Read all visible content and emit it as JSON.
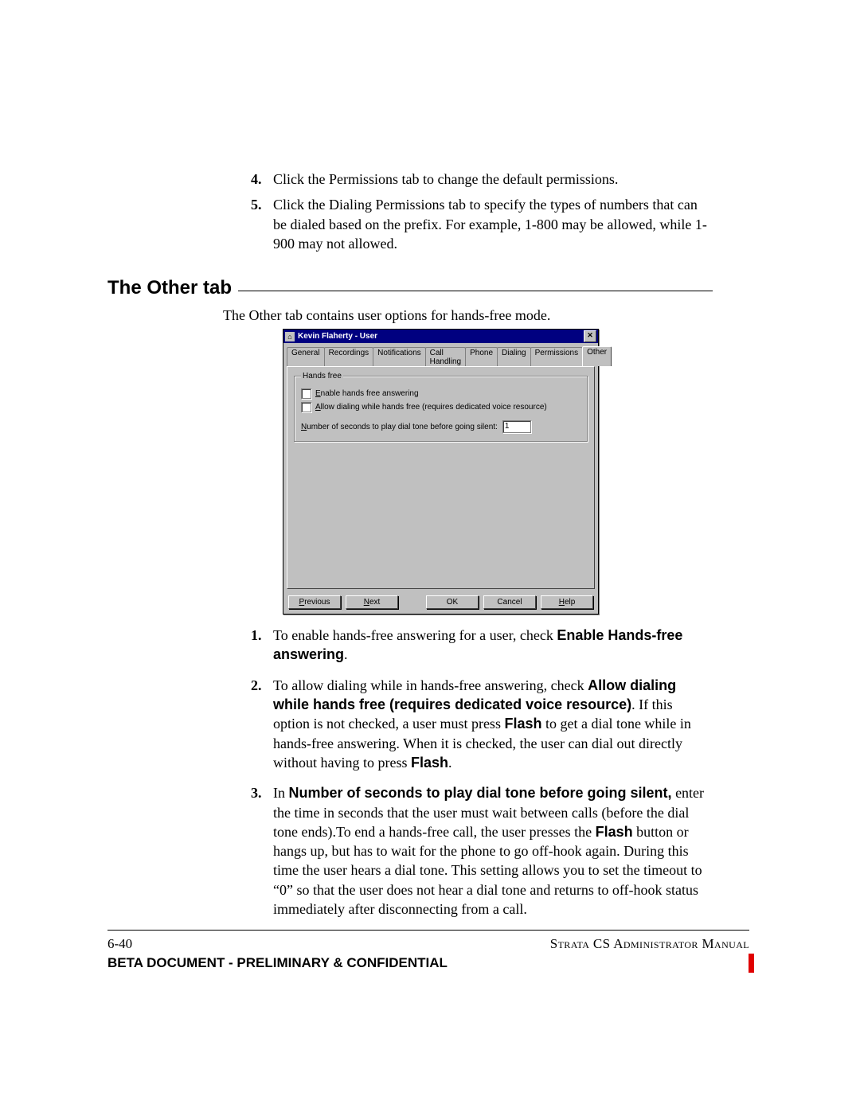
{
  "steps_before": [
    "Click the Permissions tab to change the default permissions.",
    "Click the Dialing Permissions tab to specify the types of numbers that can be dialed based on the prefix. For example, 1-800 may be allowed, while 1-900 may not allowed."
  ],
  "section_heading": "The Other tab",
  "intro": "The Other tab contains user options for hands-free mode.",
  "dialog": {
    "title": "Kevin Flaherty - User",
    "close_glyph": "✕",
    "tabs": [
      "General",
      "Recordings",
      "Notifications",
      "Call Handling",
      "Phone",
      "Dialing",
      "Permissions",
      "Other"
    ],
    "active_tab_index": 7,
    "group_legend": "Hands free",
    "check1_label": "Enable hands free answering",
    "check1_ul": "E",
    "check2_label": "Allow dialing while hands free (requires dedicated voice resource)",
    "check2_ul": "A",
    "num_label": "Number of seconds to play dial tone before going silent:",
    "num_ul": "N",
    "num_value": "1",
    "buttons": {
      "previous": "Previous",
      "next": "Next",
      "ok": "OK",
      "cancel": "Cancel",
      "help": "Help"
    }
  },
  "steps_after": {
    "1": {
      "pre": "To enable hands-free answering for a user, check ",
      "bold": "Enable Hands-free answering",
      "post": "."
    },
    "2": {
      "pre": "To allow dialing while in hands-free answering, check ",
      "bold1": "Allow dialing while hands free (requires dedicated voice resource)",
      "mid1": ". If this option is not checked, a user must press ",
      "bold2": "Flash",
      "mid2": " to get a dial tone while in hands-free answering. When it is checked, the user can dial out directly without having to press ",
      "bold3": "Flash",
      "post": "."
    },
    "3": {
      "pre": "In ",
      "bold1": "Number of seconds to play dial tone before going silent,",
      "mid1": " enter the time in seconds that the user must wait between calls (before the dial tone ends).To end a hands-free call, the user presses the ",
      "bold2": "Flash",
      "mid2": " button or hangs up, but has to wait for the phone to go off-hook again. During this time the user hears a dial tone. This setting allows you to set the timeout to “0” so that the user does not hear a dial tone and returns to off-hook status immediately after disconnecting from a call."
    }
  },
  "footer": {
    "page": "6-40",
    "right": "Strata CS Administrator Manual",
    "confidential": "BETA DOCUMENT - PRELIMINARY & CONFIDENTIAL"
  }
}
